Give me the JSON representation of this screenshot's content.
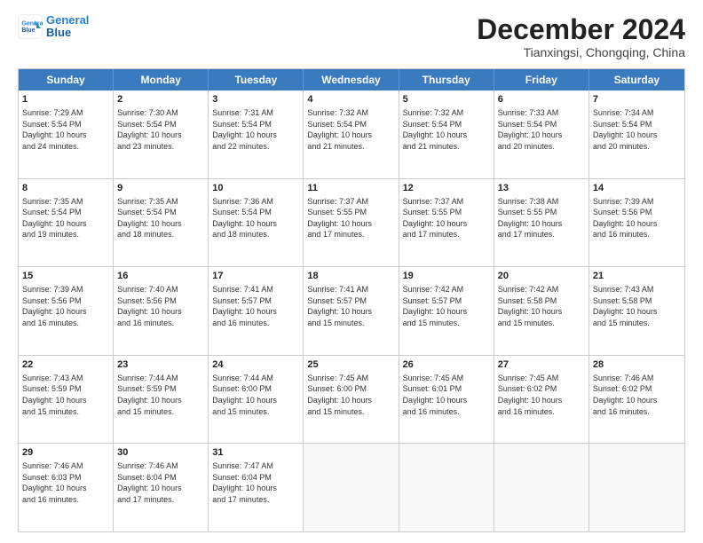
{
  "header": {
    "logo_general": "General",
    "logo_blue": "Blue",
    "month_title": "December 2024",
    "location": "Tianxingsi, Chongqing, China"
  },
  "weekdays": [
    "Sunday",
    "Monday",
    "Tuesday",
    "Wednesday",
    "Thursday",
    "Friday",
    "Saturday"
  ],
  "rows": [
    [
      {
        "day": "1",
        "lines": [
          "Sunrise: 7:29 AM",
          "Sunset: 5:54 PM",
          "Daylight: 10 hours",
          "and 24 minutes."
        ]
      },
      {
        "day": "2",
        "lines": [
          "Sunrise: 7:30 AM",
          "Sunset: 5:54 PM",
          "Daylight: 10 hours",
          "and 23 minutes."
        ]
      },
      {
        "day": "3",
        "lines": [
          "Sunrise: 7:31 AM",
          "Sunset: 5:54 PM",
          "Daylight: 10 hours",
          "and 22 minutes."
        ]
      },
      {
        "day": "4",
        "lines": [
          "Sunrise: 7:32 AM",
          "Sunset: 5:54 PM",
          "Daylight: 10 hours",
          "and 21 minutes."
        ]
      },
      {
        "day": "5",
        "lines": [
          "Sunrise: 7:32 AM",
          "Sunset: 5:54 PM",
          "Daylight: 10 hours",
          "and 21 minutes."
        ]
      },
      {
        "day": "6",
        "lines": [
          "Sunrise: 7:33 AM",
          "Sunset: 5:54 PM",
          "Daylight: 10 hours",
          "and 20 minutes."
        ]
      },
      {
        "day": "7",
        "lines": [
          "Sunrise: 7:34 AM",
          "Sunset: 5:54 PM",
          "Daylight: 10 hours",
          "and 20 minutes."
        ]
      }
    ],
    [
      {
        "day": "8",
        "lines": [
          "Sunrise: 7:35 AM",
          "Sunset: 5:54 PM",
          "Daylight: 10 hours",
          "and 19 minutes."
        ]
      },
      {
        "day": "9",
        "lines": [
          "Sunrise: 7:35 AM",
          "Sunset: 5:54 PM",
          "Daylight: 10 hours",
          "and 18 minutes."
        ]
      },
      {
        "day": "10",
        "lines": [
          "Sunrise: 7:36 AM",
          "Sunset: 5:54 PM",
          "Daylight: 10 hours",
          "and 18 minutes."
        ]
      },
      {
        "day": "11",
        "lines": [
          "Sunrise: 7:37 AM",
          "Sunset: 5:55 PM",
          "Daylight: 10 hours",
          "and 17 minutes."
        ]
      },
      {
        "day": "12",
        "lines": [
          "Sunrise: 7:37 AM",
          "Sunset: 5:55 PM",
          "Daylight: 10 hours",
          "and 17 minutes."
        ]
      },
      {
        "day": "13",
        "lines": [
          "Sunrise: 7:38 AM",
          "Sunset: 5:55 PM",
          "Daylight: 10 hours",
          "and 17 minutes."
        ]
      },
      {
        "day": "14",
        "lines": [
          "Sunrise: 7:39 AM",
          "Sunset: 5:56 PM",
          "Daylight: 10 hours",
          "and 16 minutes."
        ]
      }
    ],
    [
      {
        "day": "15",
        "lines": [
          "Sunrise: 7:39 AM",
          "Sunset: 5:56 PM",
          "Daylight: 10 hours",
          "and 16 minutes."
        ]
      },
      {
        "day": "16",
        "lines": [
          "Sunrise: 7:40 AM",
          "Sunset: 5:56 PM",
          "Daylight: 10 hours",
          "and 16 minutes."
        ]
      },
      {
        "day": "17",
        "lines": [
          "Sunrise: 7:41 AM",
          "Sunset: 5:57 PM",
          "Daylight: 10 hours",
          "and 16 minutes."
        ]
      },
      {
        "day": "18",
        "lines": [
          "Sunrise: 7:41 AM",
          "Sunset: 5:57 PM",
          "Daylight: 10 hours",
          "and 15 minutes."
        ]
      },
      {
        "day": "19",
        "lines": [
          "Sunrise: 7:42 AM",
          "Sunset: 5:57 PM",
          "Daylight: 10 hours",
          "and 15 minutes."
        ]
      },
      {
        "day": "20",
        "lines": [
          "Sunrise: 7:42 AM",
          "Sunset: 5:58 PM",
          "Daylight: 10 hours",
          "and 15 minutes."
        ]
      },
      {
        "day": "21",
        "lines": [
          "Sunrise: 7:43 AM",
          "Sunset: 5:58 PM",
          "Daylight: 10 hours",
          "and 15 minutes."
        ]
      }
    ],
    [
      {
        "day": "22",
        "lines": [
          "Sunrise: 7:43 AM",
          "Sunset: 5:59 PM",
          "Daylight: 10 hours",
          "and 15 minutes."
        ]
      },
      {
        "day": "23",
        "lines": [
          "Sunrise: 7:44 AM",
          "Sunset: 5:59 PM",
          "Daylight: 10 hours",
          "and 15 minutes."
        ]
      },
      {
        "day": "24",
        "lines": [
          "Sunrise: 7:44 AM",
          "Sunset: 6:00 PM",
          "Daylight: 10 hours",
          "and 15 minutes."
        ]
      },
      {
        "day": "25",
        "lines": [
          "Sunrise: 7:45 AM",
          "Sunset: 6:00 PM",
          "Daylight: 10 hours",
          "and 15 minutes."
        ]
      },
      {
        "day": "26",
        "lines": [
          "Sunrise: 7:45 AM",
          "Sunset: 6:01 PM",
          "Daylight: 10 hours",
          "and 16 minutes."
        ]
      },
      {
        "day": "27",
        "lines": [
          "Sunrise: 7:45 AM",
          "Sunset: 6:02 PM",
          "Daylight: 10 hours",
          "and 16 minutes."
        ]
      },
      {
        "day": "28",
        "lines": [
          "Sunrise: 7:46 AM",
          "Sunset: 6:02 PM",
          "Daylight: 10 hours",
          "and 16 minutes."
        ]
      }
    ],
    [
      {
        "day": "29",
        "lines": [
          "Sunrise: 7:46 AM",
          "Sunset: 6:03 PM",
          "Daylight: 10 hours",
          "and 16 minutes."
        ]
      },
      {
        "day": "30",
        "lines": [
          "Sunrise: 7:46 AM",
          "Sunset: 6:04 PM",
          "Daylight: 10 hours",
          "and 17 minutes."
        ]
      },
      {
        "day": "31",
        "lines": [
          "Sunrise: 7:47 AM",
          "Sunset: 6:04 PM",
          "Daylight: 10 hours",
          "and 17 minutes."
        ]
      },
      {
        "day": "",
        "lines": []
      },
      {
        "day": "",
        "lines": []
      },
      {
        "day": "",
        "lines": []
      },
      {
        "day": "",
        "lines": []
      }
    ]
  ]
}
